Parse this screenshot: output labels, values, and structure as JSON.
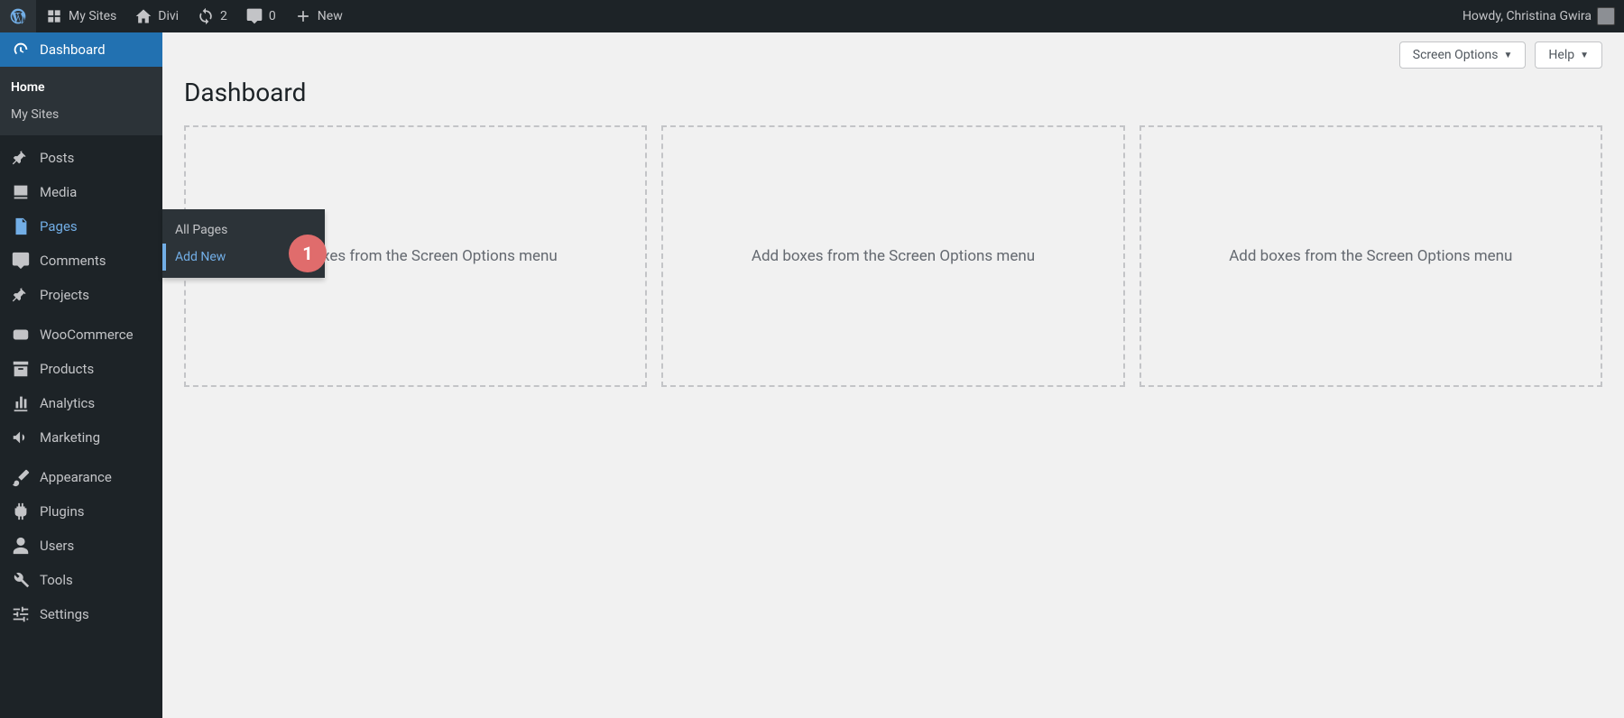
{
  "adminbar": {
    "mysites": "My Sites",
    "sitename": "Divi",
    "updates_count": "2",
    "comments_count": "0",
    "new": "New",
    "howdy": "Howdy, Christina Gwira"
  },
  "sidebar": {
    "dashboard": "Dashboard",
    "dashboard_sub": {
      "home": "Home",
      "mysites": "My Sites"
    },
    "posts": "Posts",
    "media": "Media",
    "pages": "Pages",
    "pages_fly": {
      "all": "All Pages",
      "add": "Add New"
    },
    "comments": "Comments",
    "projects": "Projects",
    "woocommerce": "WooCommerce",
    "products": "Products",
    "analytics": "Analytics",
    "marketing": "Marketing",
    "appearance": "Appearance",
    "plugins": "Plugins",
    "users": "Users",
    "tools": "Tools",
    "settings": "Settings"
  },
  "annotation": {
    "step1": "1"
  },
  "content": {
    "screen_options": "Screen Options",
    "help": "Help",
    "title": "Dashboard",
    "placeholder": "Add boxes from the Screen Options menu"
  }
}
